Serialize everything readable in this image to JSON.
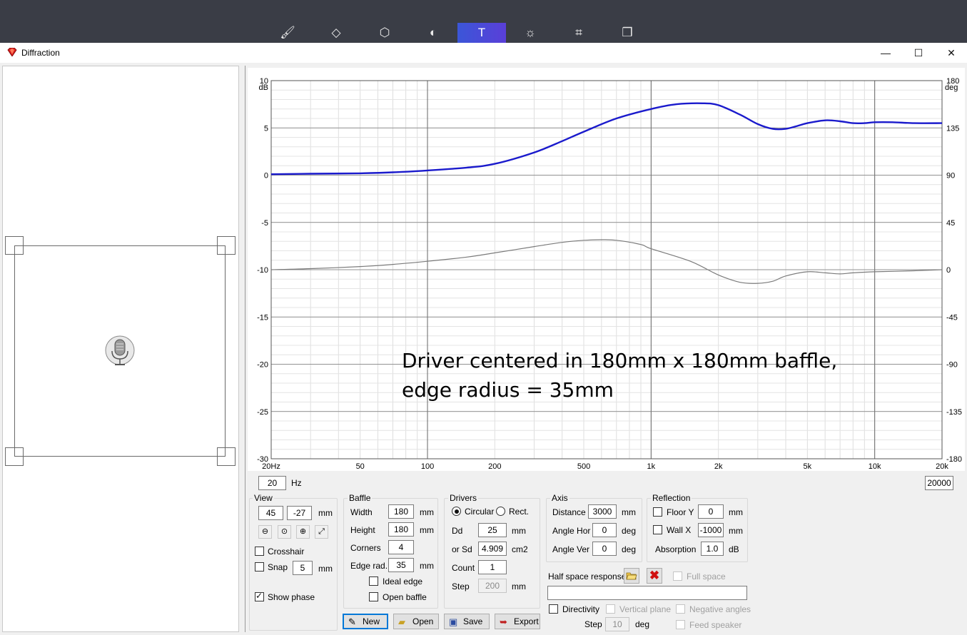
{
  "toolbar": {
    "tools": [
      {
        "name": "paint-brush-icon",
        "glyph": "🖌"
      },
      {
        "name": "shapes-icon",
        "glyph": "◇"
      },
      {
        "name": "cube-icon",
        "glyph": "⬡"
      },
      {
        "name": "palette-icon",
        "glyph": "◐"
      },
      {
        "name": "text-tool-icon",
        "glyph": "T"
      },
      {
        "name": "brightness-icon",
        "glyph": "☼"
      },
      {
        "name": "crop-icon",
        "glyph": "⌗"
      },
      {
        "name": "mixed-reality-icon",
        "glyph": "❒"
      }
    ],
    "active_index": 4
  },
  "window": {
    "title": "Diffraction",
    "minimize": "—",
    "maximize": "☐",
    "close": "✕"
  },
  "freq_range": {
    "min": "20",
    "min_unit": "Hz",
    "max": "20000"
  },
  "view": {
    "title": "View",
    "x": "45",
    "y": "-27",
    "unit": "mm",
    "crosshair_label": "Crosshair",
    "crosshair_checked": false,
    "snap_label": "Snap",
    "snap_checked": false,
    "snap_value": "5",
    "snap_unit": "mm",
    "show_phase_label": "Show phase",
    "show_phase_checked": true
  },
  "baffle": {
    "title": "Baffle",
    "width_label": "Width",
    "width": "180",
    "width_unit": "mm",
    "height_label": "Height",
    "height": "180",
    "height_unit": "mm",
    "corners_label": "Corners",
    "corners": "4",
    "edge_label": "Edge rad.",
    "edge": "35",
    "edge_unit": "mm",
    "ideal_edge_label": "Ideal edge",
    "ideal_edge_checked": false,
    "open_baffle_label": "Open baffle",
    "open_baffle_checked": false
  },
  "drivers": {
    "title": "Drivers",
    "circular_label": "Circular",
    "circular_selected": true,
    "rect_label": "Rect.",
    "dd_label": "Dd",
    "dd": "25",
    "dd_unit": "mm",
    "sd_label": "or Sd",
    "sd": "4.909",
    "sd_unit": "cm2",
    "count_label": "Count",
    "count": "1",
    "step_label": "Step",
    "step": "200",
    "step_unit": "mm"
  },
  "axis": {
    "title": "Axis",
    "distance_label": "Distance",
    "distance": "3000",
    "distance_unit": "mm",
    "angle_hor_label": "Angle Hor",
    "angle_hor": "0",
    "angle_hor_unit": "deg",
    "angle_ver_label": "Angle Ver",
    "angle_ver": "0",
    "angle_ver_unit": "deg"
  },
  "reflection": {
    "title": "Reflection",
    "floor_label": "Floor Y",
    "floor_checked": false,
    "floor": "0",
    "floor_unit": "mm",
    "wall_label": "Wall  X",
    "wall_checked": false,
    "wall": "-1000",
    "wall_unit": "mm",
    "absorption_label": "Absorption",
    "absorption": "1.0",
    "absorption_unit": "dB"
  },
  "half_space": {
    "label": "Half space response",
    "path": "",
    "full_space_label": "Full space"
  },
  "directivity": {
    "label": "Directivity",
    "checked": false,
    "vertical_plane_label": "Vertical plane",
    "negative_angles_label": "Negative angles",
    "step_label": "Step",
    "step": "10",
    "step_unit": "deg",
    "feed_speaker_label": "Feed speaker"
  },
  "buttons": {
    "new": "New",
    "open": "Open",
    "save": "Save",
    "export": "Export"
  },
  "chart_data": {
    "type": "line",
    "annotation": [
      "Driver centered in 180mm x 180mm baffle,",
      "edge radius = 35mm"
    ],
    "x_scale": "log",
    "xlim": [
      20,
      20000
    ],
    "x_ticks": [
      20,
      50,
      100,
      200,
      500,
      1000,
      2000,
      5000,
      10000,
      20000
    ],
    "x_tick_labels": [
      "20Hz",
      "50",
      "100",
      "200",
      "500",
      "1k",
      "2k",
      "5k",
      "10k",
      "20k"
    ],
    "ylim": [
      -30,
      10
    ],
    "y_ticks": [
      10,
      5,
      0,
      -5,
      -10,
      -15,
      -20,
      -25,
      -30
    ],
    "y_unit": "dB",
    "y2lim": [
      -180,
      180
    ],
    "y2_ticks": [
      180,
      135,
      90,
      45,
      0,
      -45,
      -90,
      -135,
      -180
    ],
    "y2_unit": "deg",
    "grid": true,
    "series": [
      {
        "axis": "left",
        "color": "#1a1acc",
        "x": [
          20,
          30,
          50,
          70,
          100,
          150,
          200,
          300,
          400,
          500,
          700,
          1000,
          1300,
          1700,
          2000,
          2500,
          3000,
          3500,
          4000,
          4500,
          5000,
          6000,
          7000,
          8000,
          9000,
          10000,
          12000,
          15000,
          20000
        ],
        "y": [
          0.1,
          0.15,
          0.2,
          0.3,
          0.5,
          0.8,
          1.2,
          2.4,
          3.6,
          4.6,
          6.0,
          7.0,
          7.5,
          7.6,
          7.4,
          6.4,
          5.4,
          4.9,
          4.9,
          5.2,
          5.5,
          5.8,
          5.7,
          5.5,
          5.5,
          5.6,
          5.6,
          5.5,
          5.5
        ]
      },
      {
        "axis": "right",
        "color": "#7a7a7a",
        "x": [
          20,
          30,
          50,
          70,
          100,
          150,
          200,
          300,
          400,
          500,
          600,
          700,
          900,
          1000,
          1500,
          2000,
          2500,
          3000,
          3500,
          4000,
          5000,
          6000,
          7000,
          8000,
          10000,
          15000,
          20000
        ],
        "y": [
          0,
          1,
          3,
          5,
          8,
          12,
          16,
          22,
          26,
          28,
          28.5,
          28,
          24,
          20,
          8,
          -5,
          -12,
          -13,
          -11,
          -6,
          -2,
          -3,
          -4,
          -3,
          -2,
          -1,
          0
        ]
      }
    ]
  }
}
